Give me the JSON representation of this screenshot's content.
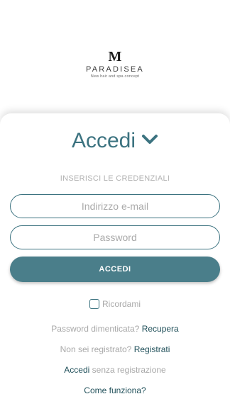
{
  "logo": {
    "mark": "M",
    "name": "PARADISEA",
    "tagline": "New hair and spa concept"
  },
  "login": {
    "title": "Accedi",
    "title_icon": "chevron-down-icon",
    "subtitle": "INSERISCI LE CREDENZIALI",
    "email_placeholder": "Indirizzo e-mail",
    "password_placeholder": "Password",
    "submit_label": "ACCEDI",
    "remember_label": "Ricordami"
  },
  "links": {
    "forgot_text": "Password dimenticata?",
    "forgot_link": "Recupera",
    "register_text": "Non sei registrato?",
    "register_link": "Registrati",
    "guest_link": "Accedi",
    "guest_text": "senza registrazione",
    "how_link": "Come funziona?"
  },
  "colors": {
    "accent": "#3c7380",
    "button": "#4a7e8a",
    "link": "#1f4f59",
    "muted": "#a8a8a8"
  }
}
